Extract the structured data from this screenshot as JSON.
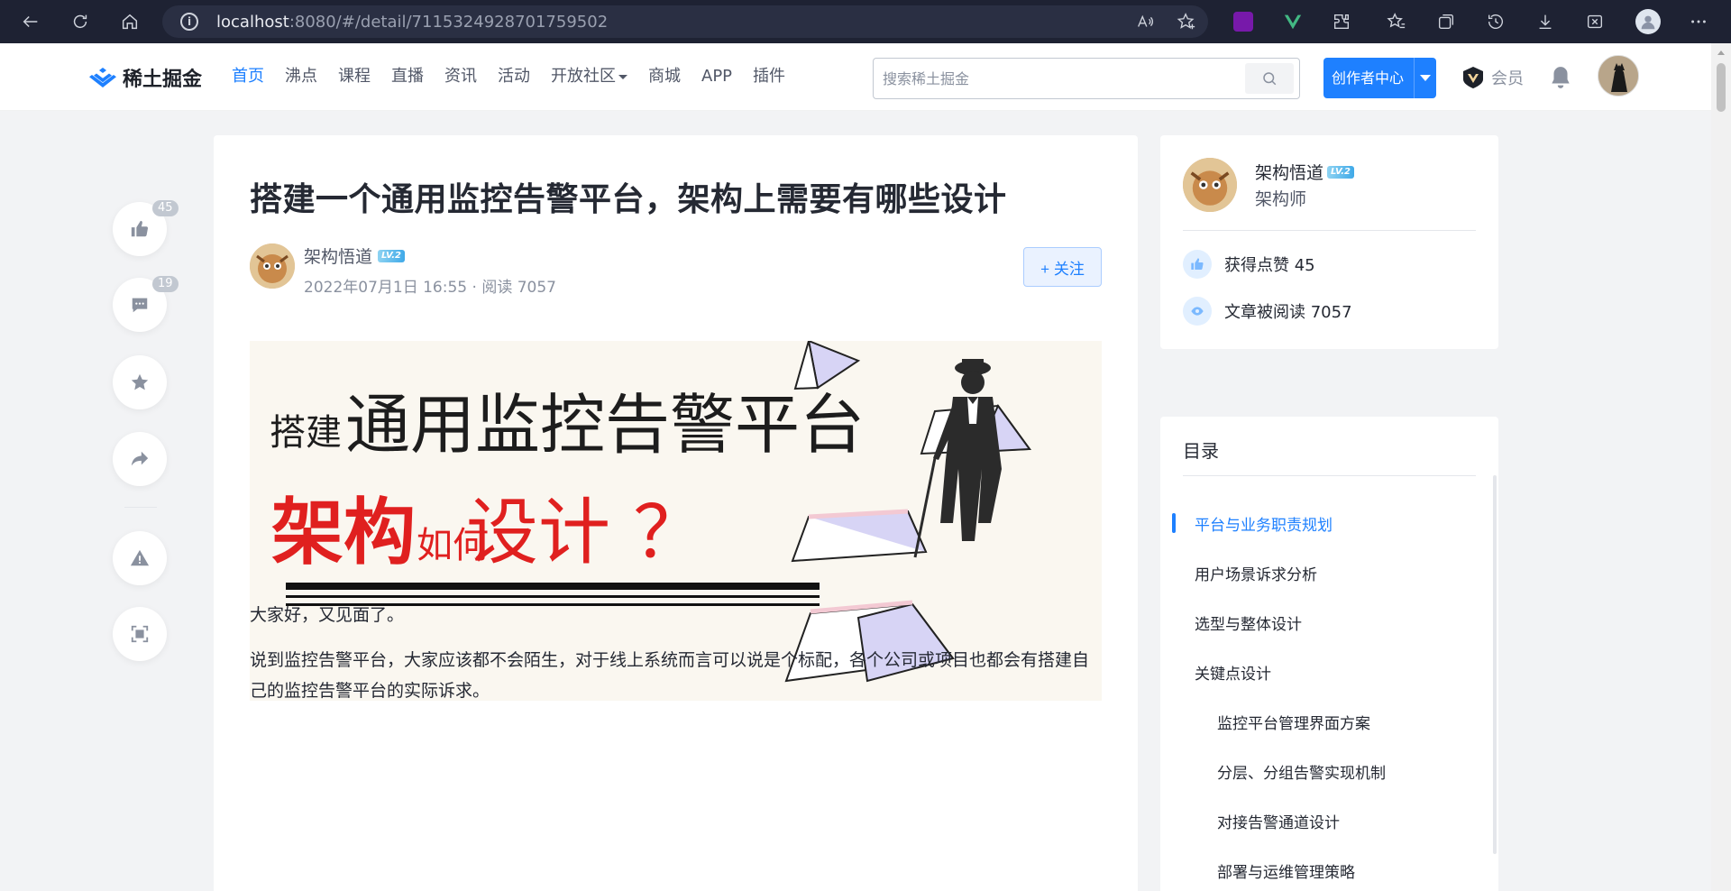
{
  "browser": {
    "url_host": "localhost",
    "url_rest": ":8080/#/detail/7115324928701759502"
  },
  "header": {
    "logo_text": "稀土掘金",
    "nav": [
      {
        "label": "首页",
        "active": true
      },
      {
        "label": "沸点"
      },
      {
        "label": "课程"
      },
      {
        "label": "直播"
      },
      {
        "label": "资讯"
      },
      {
        "label": "活动"
      },
      {
        "label": "开放社区",
        "dropdown": true
      },
      {
        "label": "商城"
      },
      {
        "label": "APP"
      },
      {
        "label": "插件"
      }
    ],
    "search_placeholder": "搜索稀土掘金",
    "creator_label": "创作者中心",
    "vip_label": "会员"
  },
  "actions": {
    "like_count": "45",
    "comment_count": "19"
  },
  "article": {
    "title": "搭建一个通用监控告警平台，架构上需要有哪些设计",
    "author": "架构悟道",
    "level": "LV.2",
    "meta": "2022年07月1日 16:55 · 阅读 7057",
    "follow_label": "+ 关注",
    "cover": {
      "line1_small": "搭建",
      "line1_big": "通用监控告警平台",
      "line2_a": "架构",
      "line2_b": "如何",
      "line2_c": "设计 ？"
    },
    "paragraphs": [
      "大家好，又见面了。",
      "说到监控告警平台，大家应该都不会陌生，对于线上系统而言可以说是个标配，各个公司或项目也都会有搭建自己的监控告警平台的实际诉求。"
    ]
  },
  "author_card": {
    "name": "架构悟道",
    "level": "LV.2",
    "role": "架构师",
    "likes_label": "获得点赞 45",
    "reads_label": "文章被阅读 7057"
  },
  "toc": {
    "title": "目录",
    "items": [
      {
        "label": "平台与业务职责规划",
        "level": 1,
        "active": true
      },
      {
        "label": "用户场景诉求分析",
        "level": 1
      },
      {
        "label": "选型与整体设计",
        "level": 1
      },
      {
        "label": "关键点设计",
        "level": 1
      },
      {
        "label": "监控平台管理界面方案",
        "level": 2
      },
      {
        "label": "分层、分组告警实现机制",
        "level": 2
      },
      {
        "label": "对接告警通道设计",
        "level": 2
      },
      {
        "label": "部署与运维管理策略",
        "level": 2
      }
    ]
  }
}
